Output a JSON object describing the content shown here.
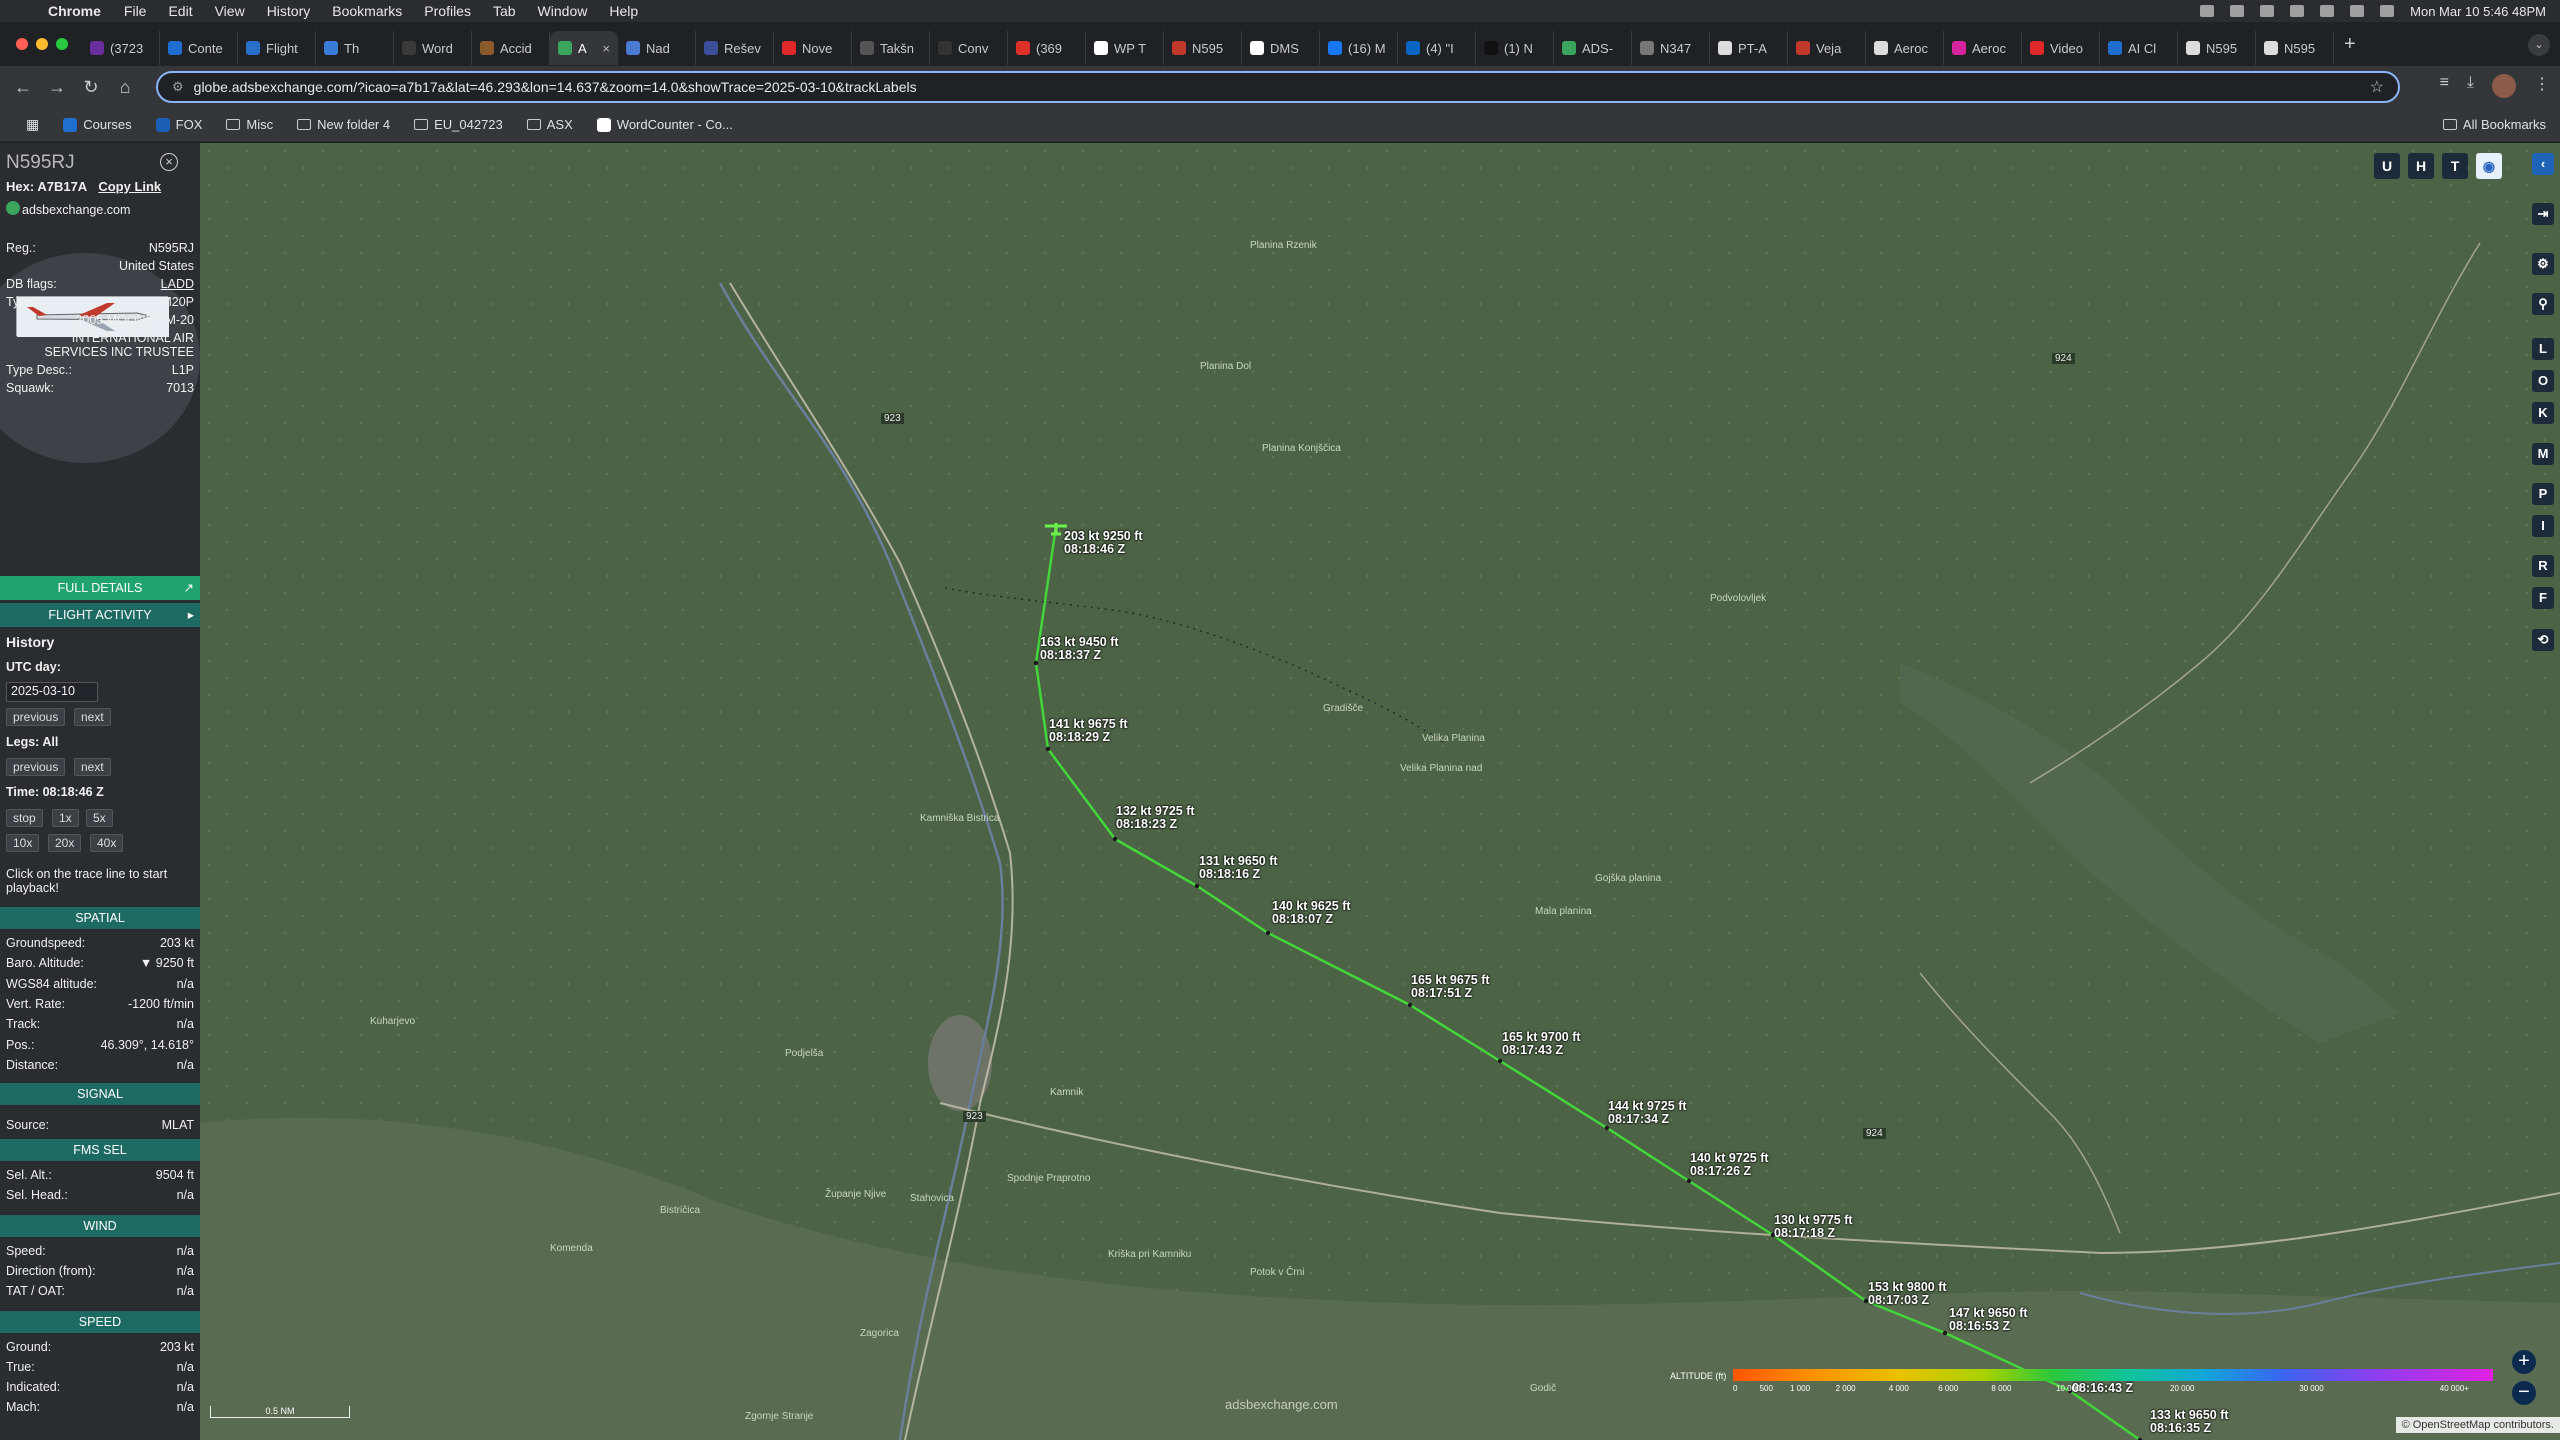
{
  "menubar": {
    "app": "Chrome",
    "items": [
      "File",
      "Edit",
      "View",
      "History",
      "Bookmarks",
      "Profiles",
      "Tab",
      "Window",
      "Help"
    ],
    "datetime": "Mon Mar 10  5:46 48PM"
  },
  "tabs": [
    {
      "title": "(3723",
      "color": "#6a2f9e"
    },
    {
      "title": "Conte",
      "color": "#1f6fd1"
    },
    {
      "title": "Flight",
      "color": "#2a6fc9"
    },
    {
      "title": "Th",
      "color": "#3b7bd8"
    },
    {
      "title": "Word",
      "color": "#3a3a3a"
    },
    {
      "title": "Accid",
      "color": "#8a5a2a"
    },
    {
      "title": "A",
      "color": "#3aa55d",
      "active": true
    },
    {
      "title": "Nad",
      "color": "#4a7bd0"
    },
    {
      "title": "Rešev",
      "color": "#3c4f9a"
    },
    {
      "title": "Nove",
      "color": "#e02a2a"
    },
    {
      "title": "Takšn",
      "color": "#555"
    },
    {
      "title": "Conv",
      "color": "#333"
    },
    {
      "title": "(369",
      "color": "#e0302a"
    },
    {
      "title": "WP T",
      "color": "#ffffff"
    },
    {
      "title": "N595",
      "color": "#c0392b"
    },
    {
      "title": "DMS",
      "color": "#ffffff"
    },
    {
      "title": "(16) M",
      "color": "#1877f2"
    },
    {
      "title": "(4) \"I",
      "color": "#0a66c2"
    },
    {
      "title": "(1) N",
      "color": "#111"
    },
    {
      "title": "ADS-",
      "color": "#3aa55d"
    },
    {
      "title": "N347",
      "color": "#777"
    },
    {
      "title": "PT-A",
      "color": "#ddd"
    },
    {
      "title": "Veja",
      "color": "#c0392b"
    },
    {
      "title": "Aeroc",
      "color": "#ddd"
    },
    {
      "title": "Aeroc",
      "color": "#d6249f"
    },
    {
      "title": "Video",
      "color": "#e02a2a"
    },
    {
      "title": "AI Cl",
      "color": "#1f6fd1"
    },
    {
      "title": "N595",
      "color": "#ddd"
    },
    {
      "title": "N595",
      "color": "#ddd"
    }
  ],
  "toolbar": {
    "url": "globe.adsbexchange.com/?icao=a7b17a&lat=46.293&lon=14.637&zoom=14.0&showTrace=2025-03-10&trackLabels"
  },
  "bookmarks": [
    {
      "label": "Courses",
      "kind": "site",
      "color": "#1f6fd1"
    },
    {
      "label": "FOX",
      "kind": "site",
      "color": "#1a5fb4"
    },
    {
      "label": "Misc",
      "kind": "folder"
    },
    {
      "label": "New folder 4",
      "kind": "folder"
    },
    {
      "label": "EU_042723",
      "kind": "folder"
    },
    {
      "label": "ASX",
      "kind": "folder"
    },
    {
      "label": "WordCounter - Co...",
      "kind": "site",
      "color": "#ffffff"
    }
  ],
  "bookmarks_all": "All Bookmarks",
  "panel": {
    "callsign": "N595RJ",
    "hex_label": "Hex:",
    "hex": "A7B17A",
    "copy_link": "Copy Link",
    "source_site": "adsbexchange.com",
    "reg_label": "Reg.:",
    "reg": "N595RJ",
    "country": "United States",
    "dbflags_label": "DB flags:",
    "dbflags": "LADD",
    "type_label": "Type:",
    "type": "M20P",
    "type_full": "2005 MOONEY M-20",
    "owner_line1": "INTERNATIONAL AIR",
    "owner_line2": "SERVICES INC TRUSTEE",
    "typedesc_label": "Type Desc.:",
    "typedesc": "L1P",
    "squawk_label": "Squawk:",
    "squawk": "7013",
    "full_details": "FULL DETAILS",
    "flight_activity": "FLIGHT ACTIVITY",
    "history_title": "History",
    "utc_day_label": "UTC day:",
    "utc_day": "2025-03-10",
    "prev": "previous",
    "next": "next",
    "legs": "Legs: All",
    "time": "Time: 08:18:46 Z",
    "speed_buttons": [
      "stop",
      "1x",
      "5x"
    ],
    "speed_buttons2": [
      "10x",
      "20x",
      "40x"
    ],
    "hint_line1": "Click on the trace line to start",
    "hint_line2": "playback!",
    "spatial": "SPATIAL",
    "spatial_rows": [
      {
        "k": "Groundspeed:",
        "v": "203 kt"
      },
      {
        "k": "Baro. Altitude:",
        "v": "▼ 9250 ft"
      },
      {
        "k": "WGS84 altitude:",
        "v": "n/a"
      },
      {
        "k": "Vert. Rate:",
        "v": "-1200 ft/min"
      },
      {
        "k": "Track:",
        "v": "n/a"
      },
      {
        "k": "Pos.:",
        "v": "46.309°, 14.618°"
      },
      {
        "k": "Distance:",
        "v": "n/a"
      }
    ],
    "signal": "SIGNAL",
    "source_label": "Source:",
    "source": "MLAT",
    "fms": "FMS SEL",
    "fms_rows": [
      {
        "k": "Sel. Alt.:",
        "v": "9504 ft"
      },
      {
        "k": "Sel. Head.:",
        "v": "n/a"
      }
    ],
    "wind": "WIND",
    "wind_rows": [
      {
        "k": "Speed:",
        "v": "n/a"
      },
      {
        "k": "Direction (from):",
        "v": "n/a"
      },
      {
        "k": "TAT / OAT:",
        "v": "n/a"
      }
    ],
    "speed": "SPEED",
    "speed_rows": [
      {
        "k": "Ground:",
        "v": "203 kt"
      },
      {
        "k": "True:",
        "v": "n/a"
      },
      {
        "k": "Indicated:",
        "v": "n/a"
      },
      {
        "k": "Mach:",
        "v": "n/a"
      }
    ]
  },
  "map": {
    "buttons": [
      "U",
      "H",
      "T"
    ],
    "side_buttons": [
      "L",
      "O",
      "K",
      "M",
      "P",
      "I",
      "R",
      "F"
    ],
    "track_labels": [
      {
        "line1": "203 kt  9250 ft",
        "line2": "08:18:46 Z"
      },
      {
        "line1": "163 kt  9450 ft",
        "line2": "08:18:37 Z"
      },
      {
        "line1": "141 kt  9675 ft",
        "line2": "08:18:29 Z"
      },
      {
        "line1": "132 kt  9725 ft",
        "line2": "08:18:23 Z"
      },
      {
        "line1": "131 kt  9650 ft",
        "line2": "08:18:16 Z"
      },
      {
        "line1": "140 kt  9625 ft",
        "line2": "08:18:07 Z"
      },
      {
        "line1": "165 kt  9675 ft",
        "line2": "08:17:51 Z"
      },
      {
        "line1": "165 kt  9700 ft",
        "line2": "08:17:43 Z"
      },
      {
        "line1": "144 kt  9725 ft",
        "line2": "08:17:34 Z"
      },
      {
        "line1": "140 kt  9725 ft",
        "line2": "08:17:26 Z"
      },
      {
        "line1": "130 kt  9775 ft",
        "line2": "08:17:18 Z"
      },
      {
        "line1": "153 kt  9800 ft",
        "line2": "08:17:03 Z"
      },
      {
        "line1": "147 kt  9650 ft",
        "line2": "08:16:53 Z"
      },
      {
        "line1": "",
        "line2": "08:16:43 Z"
      },
      {
        "line1": "133 kt  9650 ft",
        "line2": "08:16:35 Z"
      }
    ],
    "place_labels": [
      "Planina Rzenik",
      "Planina Dol",
      "Planina Konjščica",
      "Velika Planina",
      "Mala planina",
      "Gojška planina",
      "Podvolovljek",
      "Gradišče",
      "Komenda",
      "Bistričica",
      "Zgornje Stranje",
      "Kuharjevo",
      "Kamnik",
      "Kamniška Bistrica",
      "Velika Planina nad",
      "Podjelša",
      "Zagorica",
      "Županje Njive",
      "Stahovica",
      "Spodnje Praprotno",
      "Kriška pri Kamniku",
      "Potok v Črni",
      "Godič"
    ],
    "road_labels": [
      "923",
      "923",
      "924",
      "924"
    ],
    "legend_title": "ALTITUDE (ft)",
    "legend_ticks": [
      "0",
      "500",
      "1 000",
      "2 000",
      "4 000",
      "6 000",
      "8 000",
      "10 000",
      "20 000",
      "30 000",
      "40 000+"
    ],
    "scale": "0.5 NM",
    "watermark": "adsbexchange.com",
    "attribution": "© OpenStreetMap contributors."
  }
}
